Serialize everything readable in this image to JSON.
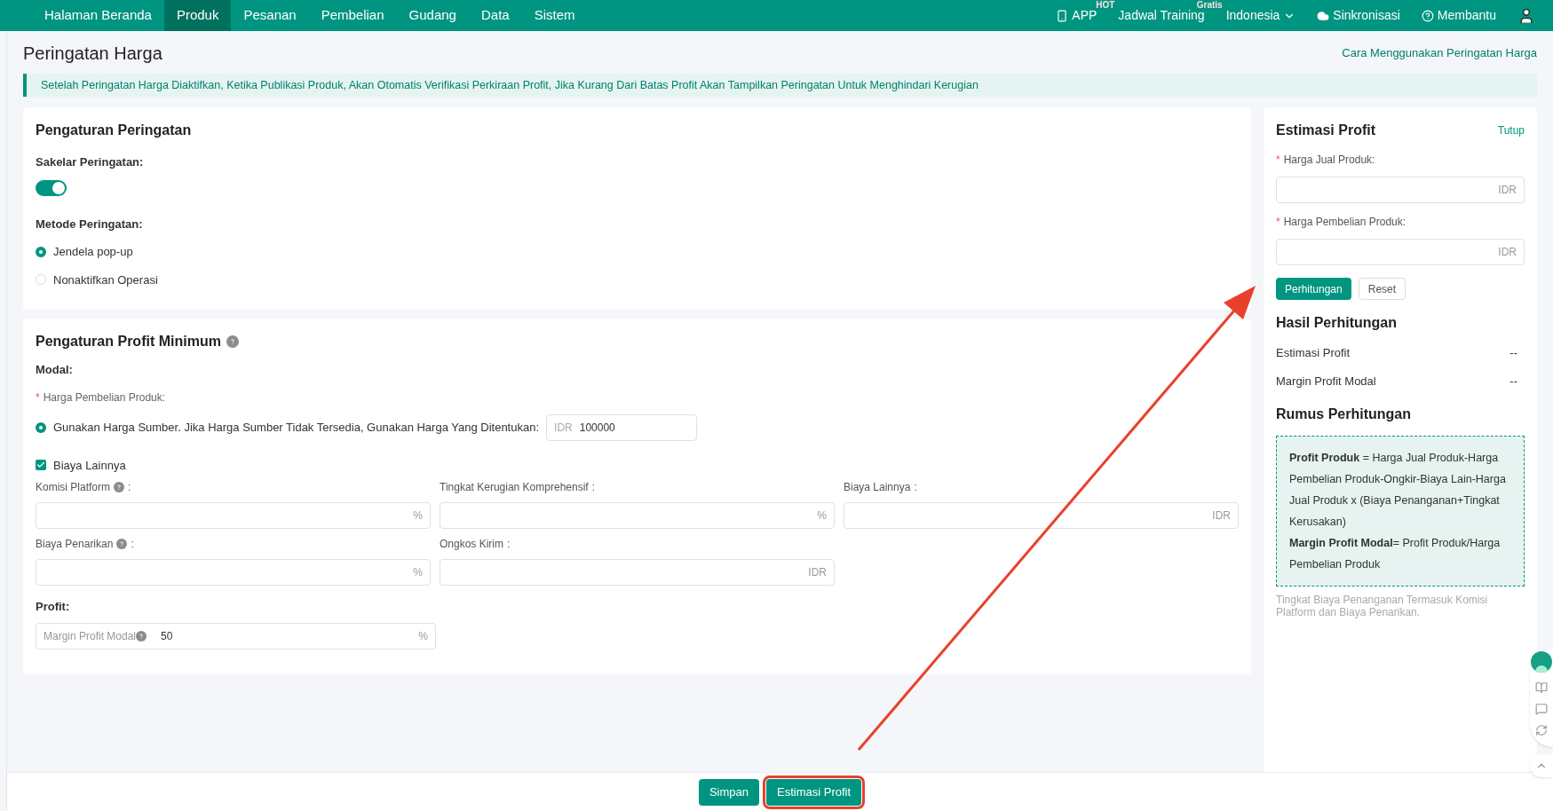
{
  "nav": {
    "items": [
      {
        "label": "Halaman Beranda",
        "selected": false
      },
      {
        "label": "Produk",
        "selected": true
      },
      {
        "label": "Pesanan",
        "selected": false
      },
      {
        "label": "Pembelian",
        "selected": false
      },
      {
        "label": "Gudang",
        "selected": false
      },
      {
        "label": "Data",
        "selected": false
      },
      {
        "label": "Sistem",
        "selected": false
      }
    ],
    "right": [
      {
        "kind": "phone",
        "label": "APP",
        "badge": "HOT"
      },
      {
        "kind": "plain",
        "label": "Jadwal Training",
        "badge": "Gratis"
      },
      {
        "kind": "dropdown",
        "label": "Indonesia"
      },
      {
        "kind": "cloud",
        "label": "Sinkronisasi"
      },
      {
        "kind": "help",
        "label": "Membantu"
      },
      {
        "kind": "user"
      }
    ]
  },
  "page": {
    "title": "Peringatan Harga",
    "help_link": "Cara Menggunakan Peringatan Harga",
    "notice": "Setelah Peringatan Harga Diaktifkan, Ketika Publikasi Produk, Akan Otomatis Verifikasi Perkiraan Profit, Jika Kurang Dari Batas Profit Akan Tampilkan Peringatan Untuk Menghindari Kerugian"
  },
  "warning_settings": {
    "title": "Pengaturan Peringatan",
    "switch_label": "Sakelar Peringatan:",
    "switch_on": true,
    "method_label": "Metode Peringatan:",
    "methods": [
      {
        "label": "Jendela pop-up",
        "selected": true
      },
      {
        "label": "Nonaktifkan Operasi",
        "selected": false
      }
    ]
  },
  "profit_settings": {
    "title": "Pengaturan Profit Minimum",
    "capital_label": "Modal:",
    "purchase_required": "*",
    "purchase_label": "Harga Pembelian Produk:",
    "source_option": {
      "label": "Gunakan Harga Sumber. Jika Harga Sumber Tidak Tersedia, Gunakan Harga Yang Ditentukan:",
      "selected": true,
      "prefix": "IDR",
      "value": "100000"
    },
    "other_costs": {
      "label": "Biaya Lainnya",
      "checked": true
    },
    "fees": [
      {
        "label": "Komisi Platform",
        "help": true,
        "colon": ":",
        "unit": "%"
      },
      {
        "label": "Tingkat Kerugian Komprehensif",
        "help": false,
        "colon": ":",
        "unit": "%"
      },
      {
        "label": "Biaya Lainnya",
        "help": false,
        "colon": ":",
        "unit": "IDR"
      },
      {
        "label": "Biaya Penarikan",
        "help": true,
        "colon": ":",
        "unit": "%"
      },
      {
        "label": "Ongkos Kirim",
        "help": false,
        "colon": ":",
        "unit": "IDR"
      }
    ],
    "profit_label": "Profit:",
    "margin": {
      "label": "Margin Profit Modal",
      "value": "50",
      "unit": "%"
    }
  },
  "estimator": {
    "title": "Estimasi Profit",
    "close": "Tutup",
    "inputs": [
      {
        "required": "*",
        "label": "Harga Jual Produk:",
        "unit": "IDR"
      },
      {
        "required": "*",
        "label": "Harga Pembelian Produk:",
        "unit": "IDR"
      }
    ],
    "calculate": "Perhitungan",
    "reset": "Reset",
    "results_title": "Hasil Perhitungan",
    "results": [
      {
        "label": "Estimasi Profit",
        "value": "--"
      },
      {
        "label": "Margin Profit Modal",
        "value": "--"
      }
    ],
    "formula_title": "Rumus Perhitungan",
    "formula": [
      "**Profit Produk** = Harga Jual Produk-Harga Pembelian Produk-Ongkir-Biaya Lain-Harga Jual Produk x (Biaya Penanganan+Tingkat Kerusakan)",
      "**Margin Profit Modal**= Profit Produk/Harga Pembelian Produk"
    ],
    "note": "Tingkat Biaya Penanganan Termasuk Komisi Platform dan Biaya Penarikan."
  },
  "footer": [
    {
      "label": "Simpan",
      "highlighted": false
    },
    {
      "label": "Estimasi Profit",
      "highlighted": true
    }
  ]
}
